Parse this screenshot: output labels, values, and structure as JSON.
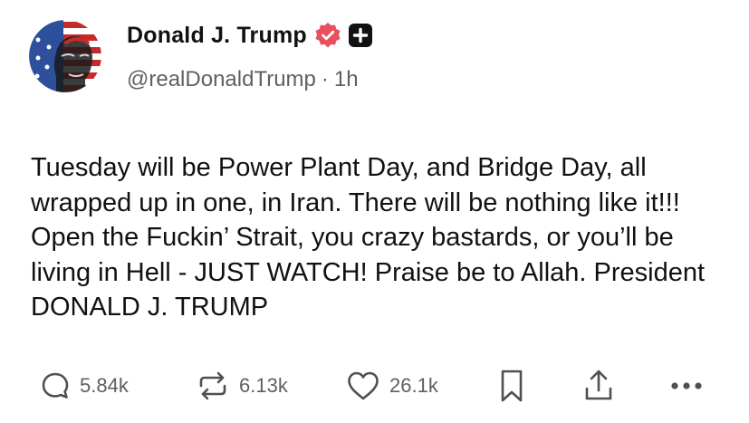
{
  "post": {
    "author_name": "Donald J. Trump",
    "handle": "@realDonaldTrump",
    "separator": "·",
    "time": "1h",
    "text": "Tuesday will be Power Plant Day, and Bridge Day, all wrapped up in one, in Iran. There will be nothing like it!!! Open the Fuckin’ Strait, you crazy bastards, or you’ll be living in Hell - JUST WATCH! Praise be to Allah. President DONALD J. TRUMP"
  },
  "actions": {
    "replies": "5.84k",
    "reposts": "6.13k",
    "likes": "26.1k"
  },
  "colors": {
    "verified": "#e8505b",
    "muted_text": "#606060",
    "icon": "#505050"
  },
  "icons": [
    "avatar",
    "verified-badge-icon",
    "plus-badge-icon",
    "reply-icon",
    "repost-icon",
    "heart-icon",
    "bookmark-icon",
    "share-icon",
    "more-icon"
  ]
}
